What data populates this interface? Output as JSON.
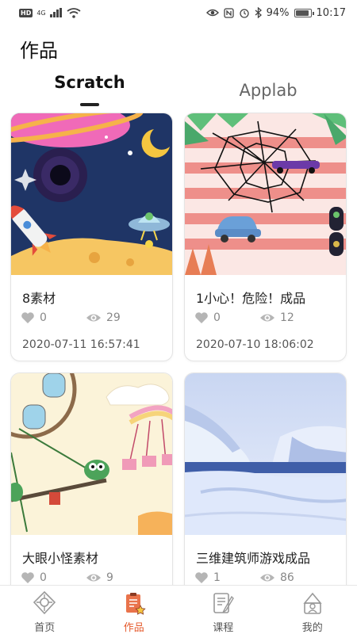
{
  "status_bar": {
    "network_badge": "HD",
    "network_type": "4G",
    "battery_percent": "94%",
    "battery_level": 0.94,
    "time": "10:17"
  },
  "page": {
    "title": "作品"
  },
  "tabs": [
    {
      "label": "Scratch",
      "active": true
    },
    {
      "label": "Applab",
      "active": false
    }
  ],
  "works": [
    {
      "title": "8素材",
      "likes": "0",
      "views": "29",
      "date": "2020-07-11 16:57:41",
      "thumbnail": "space-rocket-ufo"
    },
    {
      "title": "1小心！危险！成品",
      "likes": "0",
      "views": "12",
      "date": "2020-07-10 18:06:02",
      "thumbnail": "cracked-screen-car"
    },
    {
      "title": "大眼小怪素材",
      "likes": "0",
      "views": "9",
      "date": "",
      "thumbnail": "ferris-wheel-monsters"
    },
    {
      "title": "三维建筑师游戏成品",
      "likes": "1",
      "views": "86",
      "date": "",
      "thumbnail": "icy-landscape"
    }
  ],
  "bottom_nav": [
    {
      "label": "首页",
      "icon": "home-icon",
      "active": false
    },
    {
      "label": "作品",
      "icon": "works-icon",
      "active": true
    },
    {
      "label": "课程",
      "icon": "course-icon",
      "active": false
    },
    {
      "label": "我的",
      "icon": "profile-icon",
      "active": false
    }
  ],
  "colors": {
    "accent": "#e55a2c",
    "text": "#222222",
    "muted": "#888888"
  }
}
